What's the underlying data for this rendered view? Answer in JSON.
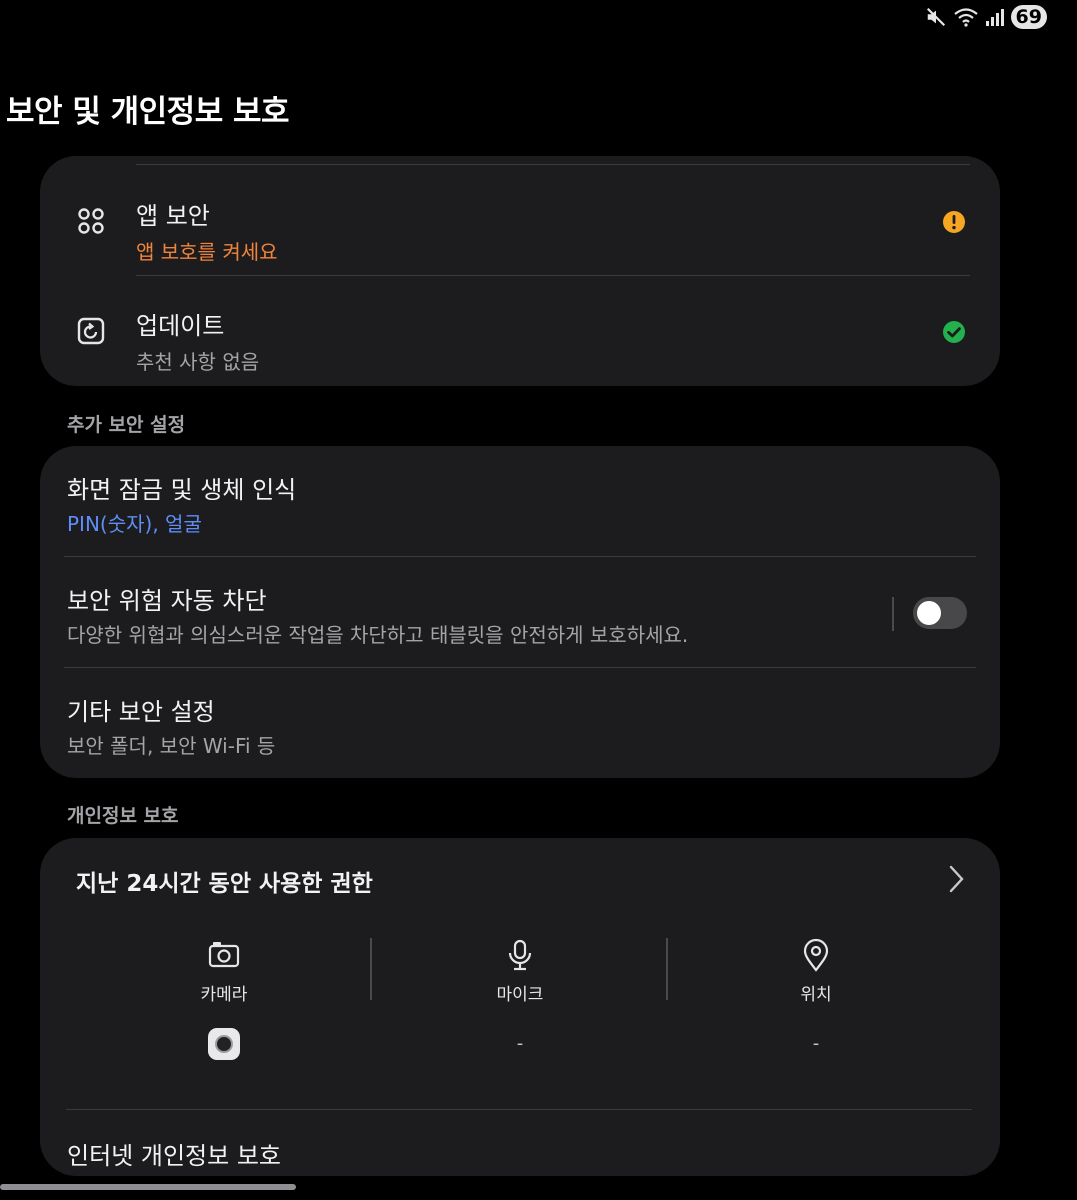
{
  "status": {
    "battery": "69",
    "icons": [
      "mute-icon",
      "wifi-icon",
      "signal-icon"
    ]
  },
  "title": "보안 및 개인정보 보호",
  "app_security": {
    "title": "앱 보안",
    "subtitle": "앱 보호를 켜세요",
    "subtitle_color": "#f0843c",
    "status_icon": "warning-icon",
    "status_color": "#f6a623"
  },
  "update": {
    "title": "업데이트",
    "subtitle": "추천 사항 없음",
    "subtitle_color": "#a4a4a8",
    "status_icon": "check-icon",
    "status_color": "#23b14d"
  },
  "extra_section": {
    "label": "추가 보안 설정",
    "items": [
      {
        "title": "화면 잠금 및 생체 인식",
        "subtitle": "PIN(숫자), 얼굴"
      },
      {
        "title": "보안 위험 자동 차단",
        "subtitle": "다양한 위협과 의심스러운 작업을 차단하고 태블릿을 안전하게 보호하세요.",
        "toggle_on": false
      },
      {
        "title": "기타 보안 설정",
        "subtitle": "보안 폴더, 보안 Wi-Fi 등"
      }
    ]
  },
  "privacy_section": {
    "label": "개인정보 보호",
    "permissions_header": "지난 24시간 동안 사용한 권한",
    "permissions": [
      {
        "label": "카메라",
        "icon": "camera-icon",
        "usage": ""
      },
      {
        "label": "마이크",
        "icon": "mic-icon",
        "usage": "-"
      },
      {
        "label": "위치",
        "icon": "location-icon",
        "usage": "-"
      }
    ],
    "internet_privacy": "인터넷 개인정보 보호"
  }
}
